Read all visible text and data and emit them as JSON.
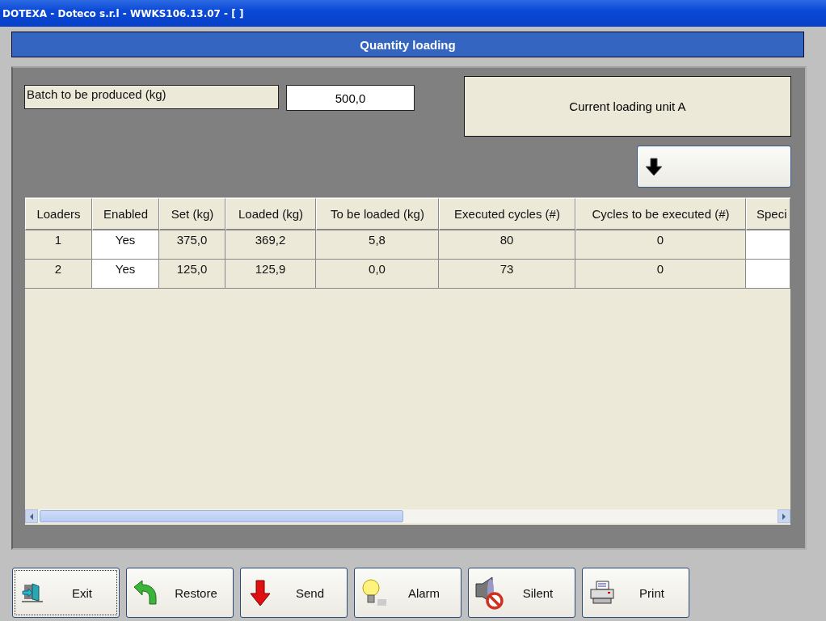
{
  "window": {
    "title": "DOTEXA - Doteco s.r.l - WWKS106.13.07 - [ ]"
  },
  "header": {
    "title": "Quantity loading"
  },
  "batch": {
    "label": "Batch to be produced (kg)",
    "value": "500,0"
  },
  "current_unit": {
    "text": "Current loading unit A"
  },
  "table": {
    "columns": [
      {
        "label": "Loaders",
        "editable": false
      },
      {
        "label": "Enabled",
        "editable": true
      },
      {
        "label": "Set (kg)",
        "editable": false
      },
      {
        "label": "Loaded (kg)",
        "editable": false
      },
      {
        "label": "To be loaded (kg)",
        "editable": false
      },
      {
        "label": "Executed cycles (#)",
        "editable": false
      },
      {
        "label": "Cycles to be executed (#)",
        "editable": false
      },
      {
        "label": "Speci",
        "editable": true
      }
    ],
    "rows": [
      [
        "1",
        "Yes",
        "375,0",
        "369,2",
        "5,8",
        "80",
        "0",
        null
      ],
      [
        "2",
        "Yes",
        "125,0",
        "125,9",
        "0,0",
        "73",
        "0",
        null
      ]
    ]
  },
  "buttons": [
    {
      "label": "Exit",
      "kind": "exit",
      "focused": true
    },
    {
      "label": "Restore",
      "kind": "restore",
      "focused": false
    },
    {
      "label": "Send",
      "kind": "send",
      "focused": false
    },
    {
      "label": "Alarm",
      "kind": "alarm",
      "focused": false
    },
    {
      "label": "Silent",
      "kind": "silent",
      "focused": false
    },
    {
      "label": "Print",
      "kind": "print",
      "focused": false
    }
  ]
}
